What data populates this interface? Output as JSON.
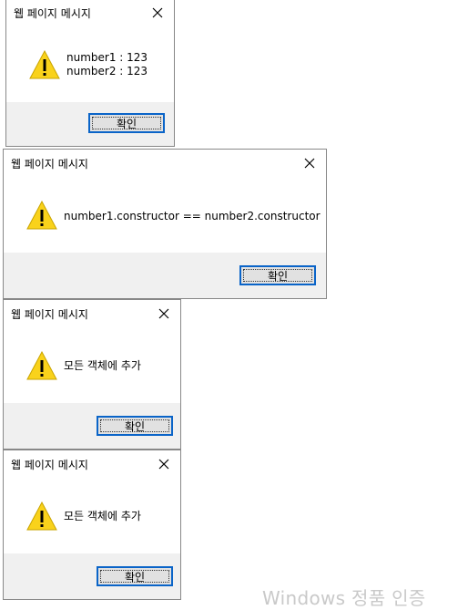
{
  "colors": {
    "button_border": "#0a64c8",
    "footer_bg": "#f0f0f0",
    "warning_fill": "#f9d21b",
    "watermark": "#c9c9c9"
  },
  "dialogs": [
    {
      "title": "웹 페이지 메시지",
      "icon": "warning-icon",
      "message_lines": [
        "number1 : 123",
        "number2 : 123"
      ],
      "ok_label": "확인"
    },
    {
      "title": "웹 페이지 메시지",
      "icon": "warning-icon",
      "message_lines": [
        "number1.constructor == number2.constructor"
      ],
      "ok_label": "확인"
    },
    {
      "title": "웹 페이지 메시지",
      "icon": "warning-icon",
      "message_lines": [
        "모든 객체에 추가"
      ],
      "ok_label": "확인"
    },
    {
      "title": "웹 페이지 메시지",
      "icon": "warning-icon",
      "message_lines": [
        "모든 객체에 추가"
      ],
      "ok_label": "확인"
    }
  ],
  "watermark": "Windows 정품 인증"
}
